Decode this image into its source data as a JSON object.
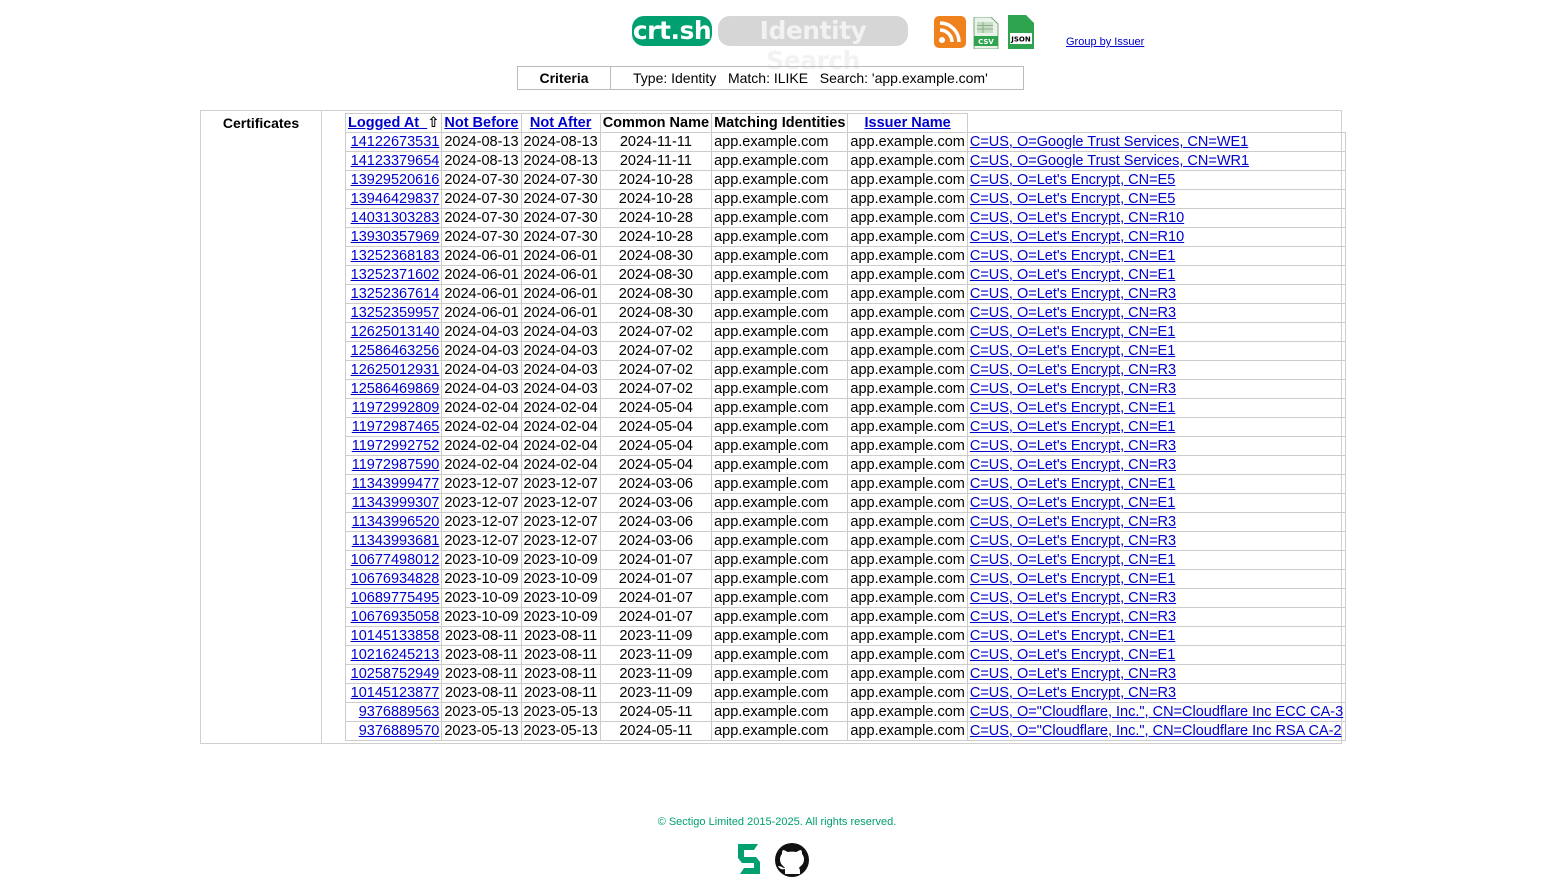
{
  "header": {
    "logo_main": "crt.sh",
    "logo_sub": "Identity Search",
    "group_by_label": "Group by Issuer",
    "icons": [
      "rss-feed-icon",
      "csv-download-icon",
      "json-download-icon"
    ],
    "csv_icon_text": "CSV",
    "json_icon_text": "JSON"
  },
  "criteria": {
    "label": "Criteria",
    "type": "Type: Identity",
    "match": "Match: ILIKE",
    "search": "Search: 'app.example.com'"
  },
  "certificates": {
    "section_label": "Certificates",
    "columns": {
      "logged_at": "Logged At",
      "sort_indicator": "⇧",
      "not_before": "Not Before",
      "not_after": "Not After",
      "common_name": "Common Name",
      "matching_identities": "Matching Identities",
      "issuer_name": "Issuer Name"
    },
    "rows": [
      [
        "14122673531",
        "2024-08-13",
        "2024-08-13",
        "2024-11-11",
        "app.example.com",
        "app.example.com",
        "C=US, O=Google Trust Services, CN=WE1"
      ],
      [
        "14123379654",
        "2024-08-13",
        "2024-08-13",
        "2024-11-11",
        "app.example.com",
        "app.example.com",
        "C=US, O=Google Trust Services, CN=WR1"
      ],
      [
        "13929520616",
        "2024-07-30",
        "2024-07-30",
        "2024-10-28",
        "app.example.com",
        "app.example.com",
        "C=US, O=Let's Encrypt, CN=E5"
      ],
      [
        "13946429837",
        "2024-07-30",
        "2024-07-30",
        "2024-10-28",
        "app.example.com",
        "app.example.com",
        "C=US, O=Let's Encrypt, CN=E5"
      ],
      [
        "14031303283",
        "2024-07-30",
        "2024-07-30",
        "2024-10-28",
        "app.example.com",
        "app.example.com",
        "C=US, O=Let's Encrypt, CN=R10"
      ],
      [
        "13930357969",
        "2024-07-30",
        "2024-07-30",
        "2024-10-28",
        "app.example.com",
        "app.example.com",
        "C=US, O=Let's Encrypt, CN=R10"
      ],
      [
        "13252368183",
        "2024-06-01",
        "2024-06-01",
        "2024-08-30",
        "app.example.com",
        "app.example.com",
        "C=US, O=Let's Encrypt, CN=E1"
      ],
      [
        "13252371602",
        "2024-06-01",
        "2024-06-01",
        "2024-08-30",
        "app.example.com",
        "app.example.com",
        "C=US, O=Let's Encrypt, CN=E1"
      ],
      [
        "13252367614",
        "2024-06-01",
        "2024-06-01",
        "2024-08-30",
        "app.example.com",
        "app.example.com",
        "C=US, O=Let's Encrypt, CN=R3"
      ],
      [
        "13252359957",
        "2024-06-01",
        "2024-06-01",
        "2024-08-30",
        "app.example.com",
        "app.example.com",
        "C=US, O=Let's Encrypt, CN=R3"
      ],
      [
        "12625013140",
        "2024-04-03",
        "2024-04-03",
        "2024-07-02",
        "app.example.com",
        "app.example.com",
        "C=US, O=Let's Encrypt, CN=E1"
      ],
      [
        "12586463256",
        "2024-04-03",
        "2024-04-03",
        "2024-07-02",
        "app.example.com",
        "app.example.com",
        "C=US, O=Let's Encrypt, CN=E1"
      ],
      [
        "12625012931",
        "2024-04-03",
        "2024-04-03",
        "2024-07-02",
        "app.example.com",
        "app.example.com",
        "C=US, O=Let's Encrypt, CN=R3"
      ],
      [
        "12586469869",
        "2024-04-03",
        "2024-04-03",
        "2024-07-02",
        "app.example.com",
        "app.example.com",
        "C=US, O=Let's Encrypt, CN=R3"
      ],
      [
        "11972992809",
        "2024-02-04",
        "2024-02-04",
        "2024-05-04",
        "app.example.com",
        "app.example.com",
        "C=US, O=Let's Encrypt, CN=E1"
      ],
      [
        "11972987465",
        "2024-02-04",
        "2024-02-04",
        "2024-05-04",
        "app.example.com",
        "app.example.com",
        "C=US, O=Let's Encrypt, CN=E1"
      ],
      [
        "11972992752",
        "2024-02-04",
        "2024-02-04",
        "2024-05-04",
        "app.example.com",
        "app.example.com",
        "C=US, O=Let's Encrypt, CN=R3"
      ],
      [
        "11972987590",
        "2024-02-04",
        "2024-02-04",
        "2024-05-04",
        "app.example.com",
        "app.example.com",
        "C=US, O=Let's Encrypt, CN=R3"
      ],
      [
        "11343999477",
        "2023-12-07",
        "2023-12-07",
        "2024-03-06",
        "app.example.com",
        "app.example.com",
        "C=US, O=Let's Encrypt, CN=E1"
      ],
      [
        "11343999307",
        "2023-12-07",
        "2023-12-07",
        "2024-03-06",
        "app.example.com",
        "app.example.com",
        "C=US, O=Let's Encrypt, CN=E1"
      ],
      [
        "11343996520",
        "2023-12-07",
        "2023-12-07",
        "2024-03-06",
        "app.example.com",
        "app.example.com",
        "C=US, O=Let's Encrypt, CN=R3"
      ],
      [
        "11343993681",
        "2023-12-07",
        "2023-12-07",
        "2024-03-06",
        "app.example.com",
        "app.example.com",
        "C=US, O=Let's Encrypt, CN=R3"
      ],
      [
        "10677498012",
        "2023-10-09",
        "2023-10-09",
        "2024-01-07",
        "app.example.com",
        "app.example.com",
        "C=US, O=Let's Encrypt, CN=E1"
      ],
      [
        "10676934828",
        "2023-10-09",
        "2023-10-09",
        "2024-01-07",
        "app.example.com",
        "app.example.com",
        "C=US, O=Let's Encrypt, CN=E1"
      ],
      [
        "10689775495",
        "2023-10-09",
        "2023-10-09",
        "2024-01-07",
        "app.example.com",
        "app.example.com",
        "C=US, O=Let's Encrypt, CN=R3"
      ],
      [
        "10676935058",
        "2023-10-09",
        "2023-10-09",
        "2024-01-07",
        "app.example.com",
        "app.example.com",
        "C=US, O=Let's Encrypt, CN=R3"
      ],
      [
        "10145133858",
        "2023-08-11",
        "2023-08-11",
        "2023-11-09",
        "app.example.com",
        "app.example.com",
        "C=US, O=Let's Encrypt, CN=E1"
      ],
      [
        "10216245213",
        "2023-08-11",
        "2023-08-11",
        "2023-11-09",
        "app.example.com",
        "app.example.com",
        "C=US, O=Let's Encrypt, CN=E1"
      ],
      [
        "10258752949",
        "2023-08-11",
        "2023-08-11",
        "2023-11-09",
        "app.example.com",
        "app.example.com",
        "C=US, O=Let's Encrypt, CN=R3"
      ],
      [
        "10145123877",
        "2023-08-11",
        "2023-08-11",
        "2023-11-09",
        "app.example.com",
        "app.example.com",
        "C=US, O=Let's Encrypt, CN=R3"
      ],
      [
        "9376889563",
        "2023-05-13",
        "2023-05-13",
        "2024-05-11",
        "app.example.com",
        "app.example.com",
        "C=US, O=\"Cloudflare, Inc.\", CN=Cloudflare Inc ECC CA-3"
      ],
      [
        "9376889570",
        "2023-05-13",
        "2023-05-13",
        "2024-05-11",
        "app.example.com",
        "app.example.com",
        "C=US, O=\"Cloudflare, Inc.\", CN=Cloudflare Inc RSA CA-2"
      ]
    ]
  },
  "footer": {
    "copyright": "© Sectigo Limited 2015-2025. All rights reserved.",
    "icons": [
      "sectigo-logo-icon",
      "github-icon"
    ]
  },
  "colors": {
    "brand_green": "#00a070",
    "link_blue": "#0000cc",
    "logo_gray": "#d6d6d6",
    "rss_orange": "#f0821e"
  }
}
